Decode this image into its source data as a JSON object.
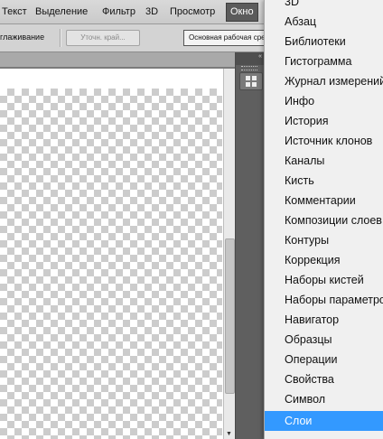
{
  "menubar": {
    "items": [
      {
        "label": "Текст"
      },
      {
        "label": "Выделение"
      },
      {
        "label": "Фильтр"
      },
      {
        "label": "3D"
      },
      {
        "label": "Просмотр"
      },
      {
        "label": "Окно"
      }
    ]
  },
  "options": {
    "smoothing_label": "глаживание",
    "refine_edge_button": "Уточн. край...",
    "workspace_value": "Основная рабочая среда"
  },
  "window_menu": {
    "items": [
      {
        "label": "3D"
      },
      {
        "label": "Абзац"
      },
      {
        "label": "Библиотеки"
      },
      {
        "label": "Гистограмма"
      },
      {
        "label": "Журнал измерений"
      },
      {
        "label": "Инфо"
      },
      {
        "label": "История"
      },
      {
        "label": "Источник клонов"
      },
      {
        "label": "Каналы"
      },
      {
        "label": "Кисть"
      },
      {
        "label": "Комментарии"
      },
      {
        "label": "Композиции слоев"
      },
      {
        "label": "Контуры"
      },
      {
        "label": "Коррекция"
      },
      {
        "label": "Наборы кистей"
      },
      {
        "label": "Наборы параметров"
      },
      {
        "label": "Навигатор"
      },
      {
        "label": "Образцы"
      },
      {
        "label": "Операции"
      },
      {
        "label": "Свойства"
      },
      {
        "label": "Символ"
      },
      {
        "label": "Слои"
      }
    ],
    "selected": "Слои"
  },
  "colors": {
    "menu_highlight": "#3399ff",
    "active_menu_bg": "#5b5b5b"
  },
  "icons": {
    "dock_button": "panel-grid-icon",
    "scroll_arrow": "arrow-down-icon",
    "dock_collapse": "double-chevron-icon"
  }
}
